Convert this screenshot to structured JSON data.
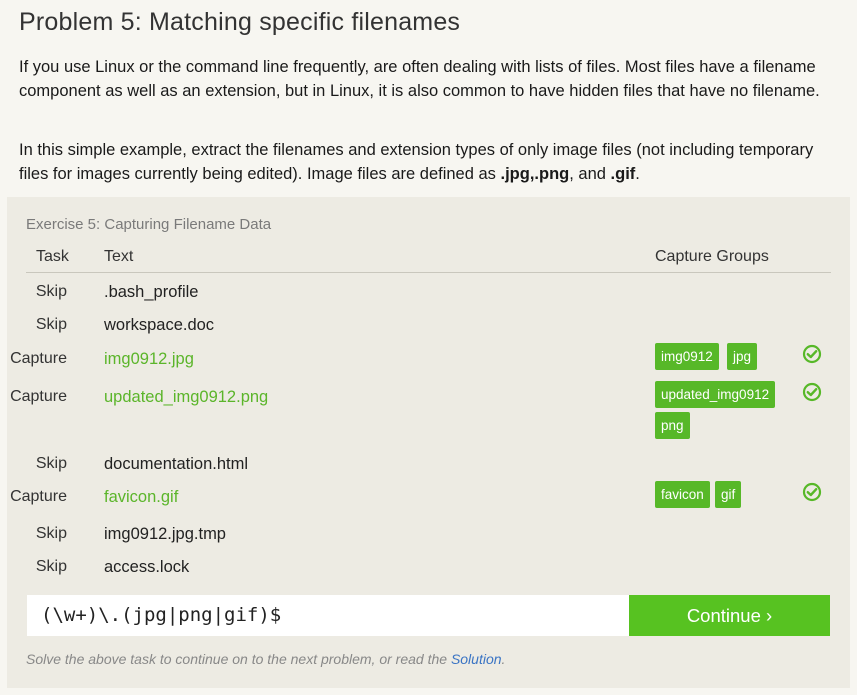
{
  "title": "Problem 5: Matching specific filenames",
  "paragraph1": "If you use Linux or the command line frequently, are often dealing with lists of files. Most files have a filename component as well as an extension, but in Linux, it is also common to have hidden files that have no filename.",
  "paragraph2": {
    "prefix": "In this simple example, extract the filenames and extension types of only image files (not including temporary files for images currently being edited). Image files are defined as ",
    "ext1": ".jpg",
    "sep1": ",",
    "ext2": ".png",
    "sep2": ", and ",
    "ext3": ".gif",
    "suffix": "."
  },
  "exercise": {
    "title": "Exercise 5: Capturing Filename Data",
    "headers": {
      "task": "Task",
      "text": "Text",
      "groups": "Capture Groups"
    },
    "rows": [
      {
        "task": "Skip",
        "text": ".bash_profile",
        "groups": []
      },
      {
        "task": "Skip",
        "text": "workspace.doc",
        "groups": []
      },
      {
        "task": "Capture",
        "text": "img0912.jpg",
        "groups": [
          "img0912",
          "jpg"
        ]
      },
      {
        "task": "Capture",
        "text": "updated_img0912.png",
        "groups": [
          "updated_img0912",
          "png"
        ]
      },
      {
        "task": "Skip",
        "text": "documentation.html",
        "groups": []
      },
      {
        "task": "Capture",
        "text": "favicon.gif",
        "groups": [
          "favicon",
          "gif"
        ]
      },
      {
        "task": "Skip",
        "text": "img0912.jpg.tmp",
        "groups": []
      },
      {
        "task": "Skip",
        "text": "access.lock",
        "groups": []
      }
    ],
    "regex_value": "(\\w+)\\.(jpg|png|gif)$",
    "continue_label": "Continue ›",
    "footer_text": "Solve the above task to continue on to the next problem, or read the ",
    "footer_link": "Solution",
    "footer_end": "."
  },
  "icons": {
    "check": "check-circle-icon"
  },
  "colors": {
    "accent": "#57c221",
    "capture_text": "#5bb52a",
    "link": "#3a74c4"
  }
}
